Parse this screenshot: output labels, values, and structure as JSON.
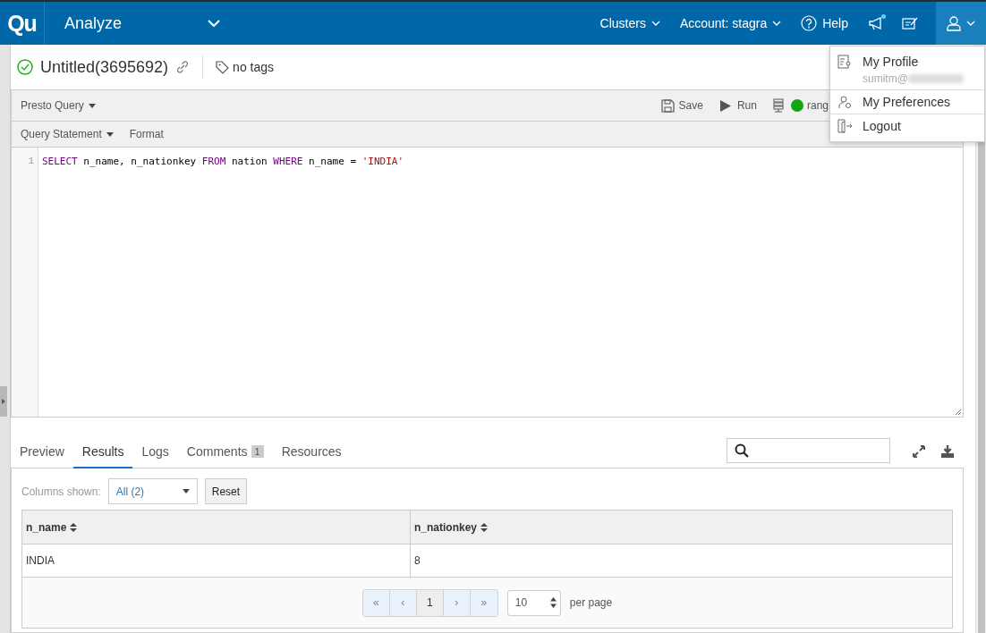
{
  "navbar": {
    "logo": "Qu",
    "app": "Analyze",
    "menus": [
      {
        "kind": "dropdown",
        "label": "Clusters"
      },
      {
        "kind": "dropdown",
        "label": "Account: stagra"
      },
      {
        "kind": "help",
        "label": "Help"
      }
    ],
    "has_unread": true
  },
  "user_menu": {
    "expanded": true,
    "items": [
      {
        "kind": "profile",
        "label": "My Profile",
        "detail": "sumitm@"
      },
      {
        "kind": "preferences",
        "label": "My Preferences"
      },
      {
        "kind": "logout",
        "label": "Logout"
      }
    ]
  },
  "query": {
    "succeeded": true,
    "title": "Untitled(3695692)",
    "tags": "no tags",
    "type": "Presto Query",
    "actions": [
      {
        "kind": "save",
        "label": "Save"
      },
      {
        "kind": "run",
        "label": "Run"
      }
    ],
    "cluster": {
      "label": "rang",
      "running": true
    }
  },
  "editor": {
    "mode": "Query Statement",
    "format": "Format",
    "lines": [
      {
        "number": "1",
        "tokens": [
          {
            "kind": "keyword",
            "text": "SELECT"
          },
          {
            "kind": "plain",
            "text": " n_name, n_nationkey "
          },
          {
            "kind": "keyword",
            "text": "FROM"
          },
          {
            "kind": "plain",
            "text": " nation "
          },
          {
            "kind": "keyword",
            "text": "WHERE"
          },
          {
            "kind": "plain",
            "text": " n_name = "
          },
          {
            "kind": "string",
            "text": "'INDIA'"
          }
        ]
      }
    ]
  },
  "result_tabs": [
    {
      "label": "Preview",
      "selected": false
    },
    {
      "label": "Results",
      "selected": true
    },
    {
      "label": "Logs",
      "selected": false
    },
    {
      "label": "Comments",
      "selected": false,
      "badge": "1"
    },
    {
      "label": "Resources",
      "selected": false
    }
  ],
  "columns_filter": {
    "label": "Columns shown:",
    "value": "All (2)",
    "reset": "Reset"
  },
  "table": {
    "columns": [
      "n_name",
      "n_nationkey"
    ],
    "rows": [
      [
        "INDIA",
        "8"
      ]
    ]
  },
  "pagination": [
    {
      "label": "«",
      "disabled": true,
      "selected": false
    },
    {
      "label": "‹",
      "disabled": true,
      "selected": false
    },
    {
      "label": "1",
      "disabled": false,
      "selected": true
    },
    {
      "label": "›",
      "disabled": true,
      "selected": false
    },
    {
      "label": "»",
      "disabled": true,
      "selected": false
    }
  ],
  "per_page": {
    "value": "10",
    "label": "per page"
  }
}
